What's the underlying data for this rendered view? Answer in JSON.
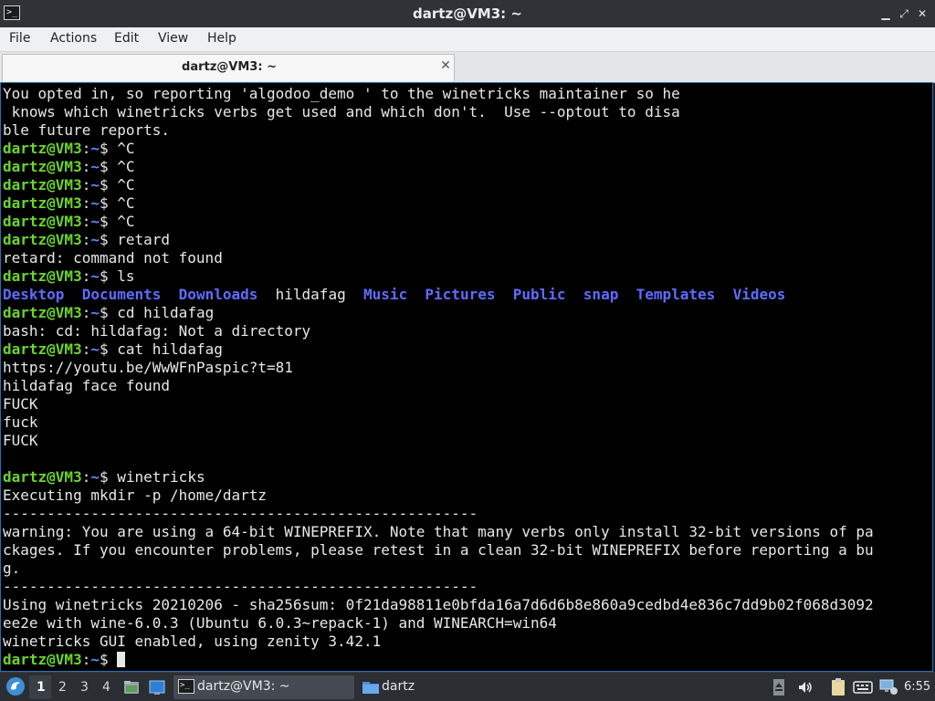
{
  "window": {
    "title": "dartz@VM3: ~"
  },
  "menu": [
    {
      "id": "file",
      "label": "File"
    },
    {
      "id": "actions",
      "label": "Actions"
    },
    {
      "id": "edit",
      "label": "Edit"
    },
    {
      "id": "view",
      "label": "View"
    },
    {
      "id": "help",
      "label": "Help"
    }
  ],
  "tab": {
    "label": "dartz@VM3: ~"
  },
  "prompt": {
    "user": "dartz@VM3",
    "colon": ":",
    "path": "~",
    "dollar": "$ "
  },
  "terminal": {
    "lines": [
      {
        "type": "out",
        "text": "You opted in, so reporting 'algodoo_demo ' to the winetricks maintainer so he"
      },
      {
        "type": "out",
        "text": " knows which winetricks verbs get used and which don't.  Use --optout to disa"
      },
      {
        "type": "out",
        "text": "ble future reports."
      },
      {
        "type": "prompt",
        "cmd": "^C"
      },
      {
        "type": "prompt",
        "cmd": "^C"
      },
      {
        "type": "prompt",
        "cmd": "^C"
      },
      {
        "type": "prompt",
        "cmd": "^C"
      },
      {
        "type": "prompt",
        "cmd": "^C"
      },
      {
        "type": "prompt",
        "cmd": "retard"
      },
      {
        "type": "out",
        "text": "retard: command not found"
      },
      {
        "type": "prompt",
        "cmd": "ls"
      },
      {
        "type": "ls",
        "items": [
          {
            "text": "Desktop",
            "dir": true
          },
          {
            "text": "Documents",
            "dir": true
          },
          {
            "text": "Downloads",
            "dir": true
          },
          {
            "text": "hildafag",
            "dir": false
          },
          {
            "text": "Music",
            "dir": true
          },
          {
            "text": "Pictures",
            "dir": true
          },
          {
            "text": "Public",
            "dir": true
          },
          {
            "text": "snap",
            "dir": true
          },
          {
            "text": "Templates",
            "dir": true
          },
          {
            "text": "Videos",
            "dir": true
          }
        ]
      },
      {
        "type": "prompt",
        "cmd": "cd hildafag"
      },
      {
        "type": "out",
        "text": "bash: cd: hildafag: Not a directory"
      },
      {
        "type": "prompt",
        "cmd": "cat hildafag"
      },
      {
        "type": "out",
        "text": "https://youtu.be/WwWFnPaspic?t=81"
      },
      {
        "type": "out",
        "text": "hildafag face found"
      },
      {
        "type": "out",
        "text": "FUCK"
      },
      {
        "type": "out",
        "text": "fuck"
      },
      {
        "type": "out",
        "text": "FUCK"
      },
      {
        "type": "out",
        "text": ""
      },
      {
        "type": "prompt",
        "cmd": "winetricks"
      },
      {
        "type": "out",
        "text": "Executing mkdir -p /home/dartz"
      },
      {
        "type": "out",
        "text": "------------------------------------------------------"
      },
      {
        "type": "out",
        "text": "warning: You are using a 64-bit WINEPREFIX. Note that many verbs only install 32-bit versions of pa"
      },
      {
        "type": "out",
        "text": "ckages. If you encounter problems, please retest in a clean 32-bit WINEPREFIX before reporting a bu"
      },
      {
        "type": "out",
        "text": "g."
      },
      {
        "type": "out",
        "text": "------------------------------------------------------"
      },
      {
        "type": "out",
        "text": "Using winetricks 20210206 - sha256sum: 0f21da98811e0bfda16a7d6d6b8e860a9cedbd4e836c7dd9b02f068d3092"
      },
      {
        "type": "out",
        "text": "ee2e with wine-6.0.3 (Ubuntu 6.0.3~repack-1) and WINEARCH=win64"
      },
      {
        "type": "out",
        "text": "winetricks GUI enabled, using zenity 3.42.1"
      },
      {
        "type": "prompt",
        "cmd": "",
        "cursor": true
      }
    ]
  },
  "taskbar": {
    "workspaces": [
      "1",
      "2",
      "3",
      "4"
    ],
    "active_workspace": "1",
    "tasks": [
      {
        "label": "dartz@VM3: ~",
        "icon": "terminal-icon",
        "active": true
      },
      {
        "label": "dartz",
        "icon": "folder-icon",
        "active": false
      }
    ],
    "clock": "6:55"
  }
}
